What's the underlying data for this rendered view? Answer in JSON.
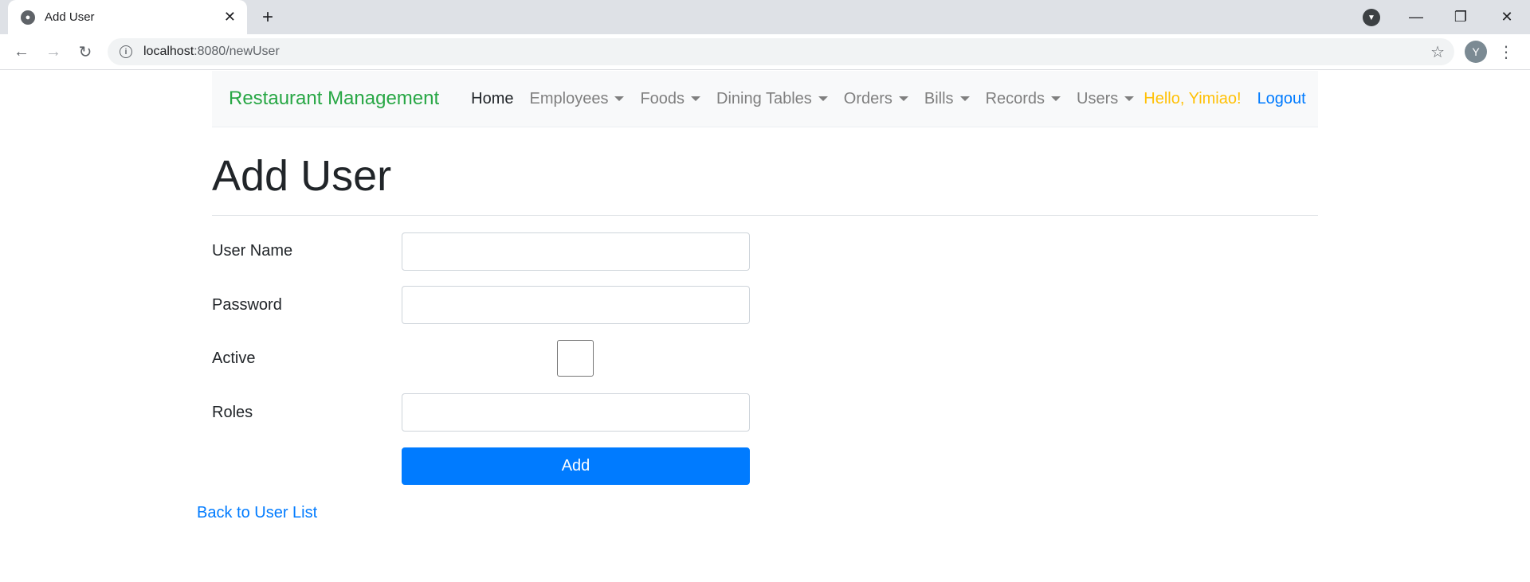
{
  "browser": {
    "tab_title": "Add User",
    "url_host": "localhost",
    "url_path": ":8080/newUser",
    "profile_initial": "Y"
  },
  "nav": {
    "brand": "Restaurant Management",
    "items": [
      {
        "label": "Home",
        "dropdown": false
      },
      {
        "label": "Employees",
        "dropdown": true
      },
      {
        "label": "Foods",
        "dropdown": true
      },
      {
        "label": "Dining Tables",
        "dropdown": true
      },
      {
        "label": "Orders",
        "dropdown": true
      },
      {
        "label": "Bills",
        "dropdown": true
      },
      {
        "label": "Records",
        "dropdown": true
      },
      {
        "label": "Users",
        "dropdown": true
      }
    ],
    "greeting": "Hello, Yimiao!",
    "logout": "Logout"
  },
  "page": {
    "title": "Add User"
  },
  "form": {
    "username_label": "User Name",
    "username_value": "",
    "password_label": "Password",
    "password_value": "",
    "active_label": "Active",
    "active_checked": false,
    "roles_label": "Roles",
    "roles_value": "",
    "submit_label": "Add"
  },
  "back_link": "Back to User List",
  "colors": {
    "brand": "#28a745",
    "primary": "#007bff",
    "greeting": "#ffc107"
  }
}
